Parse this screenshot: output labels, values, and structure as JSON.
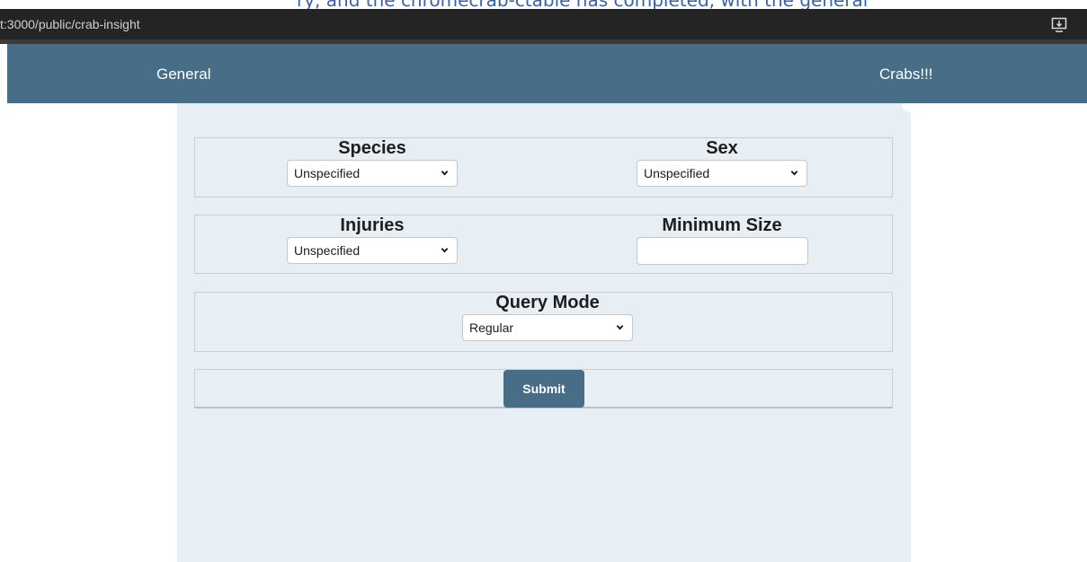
{
  "browser": {
    "top_text": "ry, and the chromecrab-ctable has completed, with the general",
    "url": "t:3000/public/crab-insight"
  },
  "nav": {
    "general": "General",
    "crabs": "Crabs!!!"
  },
  "form": {
    "species": {
      "label": "Species",
      "value": "Unspecified"
    },
    "sex": {
      "label": "Sex",
      "value": "Unspecified"
    },
    "injuries": {
      "label": "Injuries",
      "value": "Unspecified"
    },
    "min_size": {
      "label": "Minimum Size",
      "value": ""
    },
    "query_mode": {
      "label": "Query Mode",
      "value": "Regular"
    },
    "submit": "Submit"
  },
  "colors": {
    "navbar": "#486d87",
    "panel": "#e7eef4",
    "browser_bar": "#242424"
  }
}
